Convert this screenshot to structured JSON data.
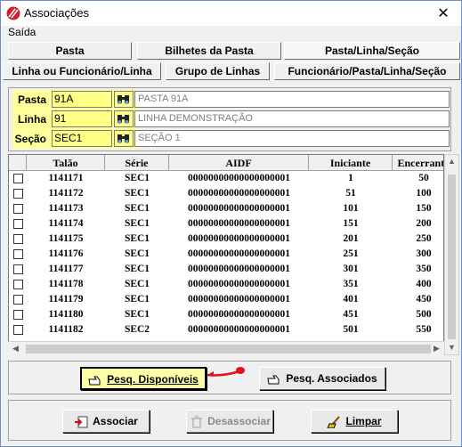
{
  "window": {
    "title": "Associações",
    "close_glyph": "✕"
  },
  "menu": {
    "saida_label": "Saída"
  },
  "tabs_row1": [
    "Pasta",
    "Bilhetes da Pasta",
    "Pasta/Linha/Seção"
  ],
  "tabs_row2": [
    "Linha ou Funcionário/Linha",
    "Grupo de Linhas",
    "Funcionário/Pasta/Linha/Seção"
  ],
  "active_tab": "Pasta/Linha/Seção",
  "filters": {
    "pasta": {
      "label": "Pasta",
      "code": "91A",
      "description": "PASTA 91A"
    },
    "linha": {
      "label": "Linha",
      "code": "91",
      "description": "LINHA DEMONSTRAÇÃO"
    },
    "secao": {
      "label": "Seção",
      "code": "SEC1",
      "description": "SEÇÃO 1"
    }
  },
  "grid": {
    "columns": [
      "",
      "Talão",
      "Série",
      "AIDF",
      "Iniciante",
      "Encerrante"
    ],
    "rows": [
      [
        "1141171",
        "SEC1",
        "00000000000000000001",
        "1",
        "50"
      ],
      [
        "1141172",
        "SEC1",
        "00000000000000000001",
        "51",
        "100"
      ],
      [
        "1141173",
        "SEC1",
        "00000000000000000001",
        "101",
        "150"
      ],
      [
        "1141174",
        "SEC1",
        "00000000000000000001",
        "151",
        "200"
      ],
      [
        "1141175",
        "SEC1",
        "00000000000000000001",
        "201",
        "250"
      ],
      [
        "1141176",
        "SEC1",
        "00000000000000000001",
        "251",
        "300"
      ],
      [
        "1141177",
        "SEC1",
        "00000000000000000001",
        "301",
        "350"
      ],
      [
        "1141178",
        "SEC1",
        "00000000000000000001",
        "351",
        "400"
      ],
      [
        "1141179",
        "SEC1",
        "00000000000000000001",
        "401",
        "450"
      ],
      [
        "1141180",
        "SEC1",
        "00000000000000000001",
        "451",
        "500"
      ],
      [
        "1141182",
        "SEC2",
        "00000000000000000001",
        "501",
        "550"
      ]
    ]
  },
  "buttons": {
    "pesq_disponiveis": "Pesq. Disponíveis",
    "pesq_associados": "Pesq. Associados",
    "associar": "Associar",
    "desassociar": "Desassociar",
    "limpar": "Limpar"
  },
  "colors": {
    "filter_yellow": "#ffff9c",
    "highlight_button": "#ffffa8",
    "pointer_red": "#e0121b"
  }
}
